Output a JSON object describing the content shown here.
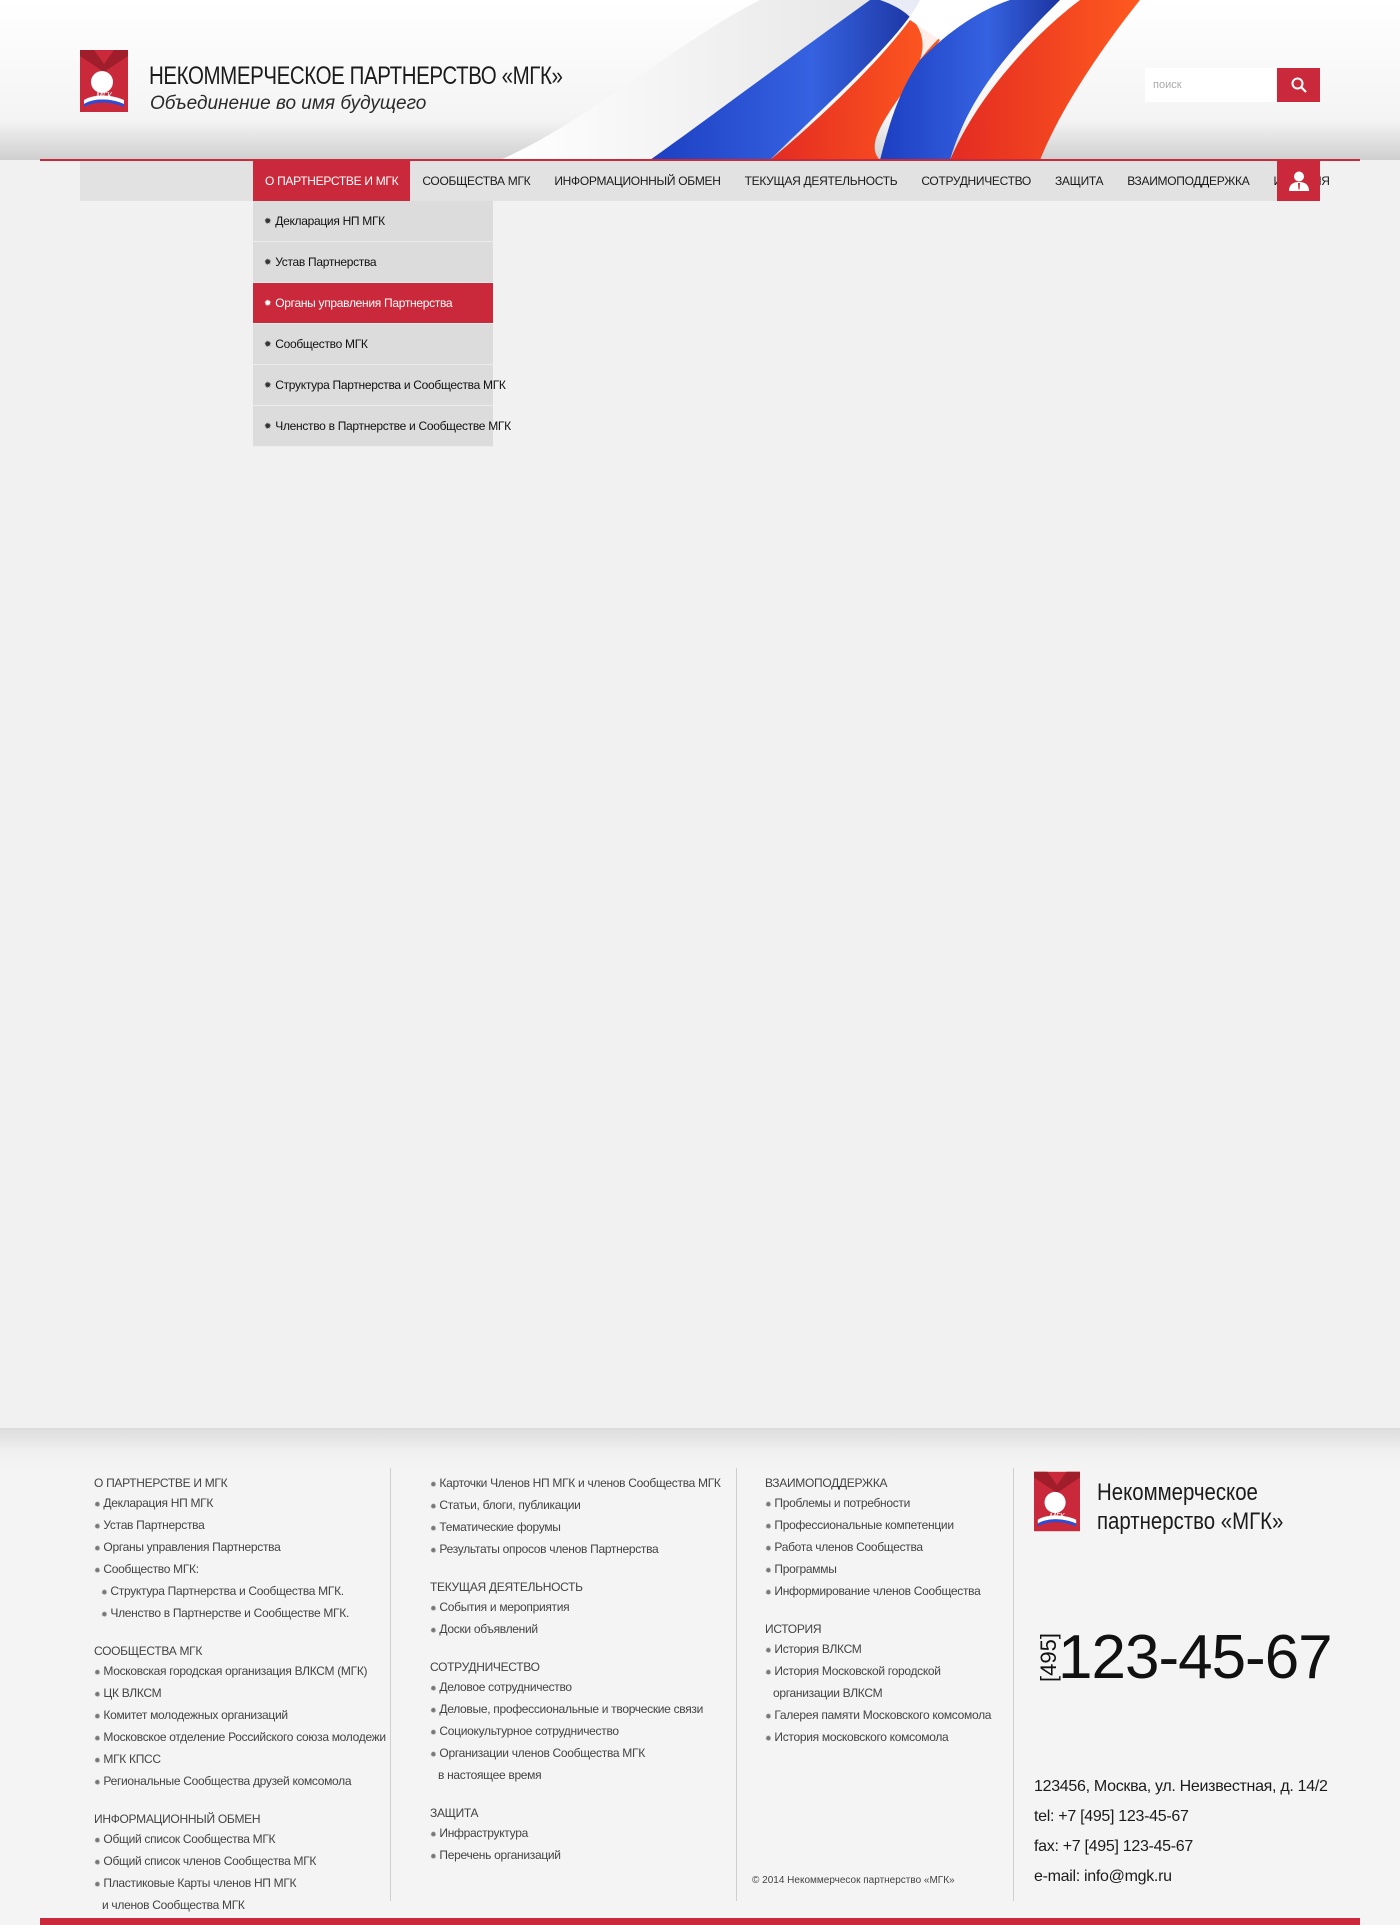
{
  "brand": {
    "title": "НЕКОММЕРЧЕСКОЕ ПАРТНЕРСТВО «МГК»",
    "tagline": "Объединение во имя будущего",
    "logo_text": "МГК"
  },
  "colors": {
    "accent": "#c9293a",
    "nav_bg": "#e2e2e2",
    "page_bg": "#f1f1f1"
  },
  "search": {
    "placeholder": "поиск"
  },
  "nav": {
    "items": [
      {
        "label": "О ПАРТНЕРСТВЕ И МГК",
        "active": true
      },
      {
        "label": "СООБЩЕСТВА МГК"
      },
      {
        "label": "ИНФОРМАЦИОННЫЙ ОБМЕН"
      },
      {
        "label": "ТЕКУЩАЯ ДЕЯТЕЛЬНОСТЬ"
      },
      {
        "label": "СОТРУДНИЧЕСТВО"
      },
      {
        "label": "ЗАЩИТА"
      },
      {
        "label": "ВЗАИМОПОДДЕРЖКА"
      },
      {
        "label": "ИСТОРИЯ"
      }
    ]
  },
  "dropdown": {
    "items": [
      {
        "label": "Декларация НП МГК"
      },
      {
        "label": "Устав Партнерства"
      },
      {
        "label": "Органы управления Партнерства",
        "active": true
      },
      {
        "label": "Сообщество МГК"
      },
      {
        "label": "Структура Партнерства и Сообщества МГК"
      },
      {
        "label": "Членство в Партнерстве и Сообществе МГК"
      }
    ]
  },
  "footer": {
    "col1": [
      {
        "head": "О ПАРТНЕРСТВЕ И МГК",
        "links": [
          {
            "t": "Декларация НП МГК"
          },
          {
            "t": "Устав Партнерства"
          },
          {
            "t": "Органы управления Партнерства"
          },
          {
            "t": "Сообщество МГК:"
          },
          {
            "t": "Структура Партнерства и Сообщества МГК.",
            "sub": true
          },
          {
            "t": "Членство в Партнерстве и Сообществе МГК.",
            "sub": true
          }
        ]
      },
      {
        "head": "СООБЩЕСТВА МГК",
        "links": [
          {
            "t": "Московская городская организация ВЛКСМ (МГК)"
          },
          {
            "t": "ЦК ВЛКСМ"
          },
          {
            "t": "Комитет молодежных организаций"
          },
          {
            "t": "Московское отделение Российского союза молодежи"
          },
          {
            "t": "МГК КПСС"
          },
          {
            "t": "Региональные Сообщества друзей комсомола"
          }
        ]
      },
      {
        "head": "ИНФОРМАЦИОННЫЙ ОБМЕН",
        "links": [
          {
            "t": "Общий список Сообщества МГК"
          },
          {
            "t": "Общий список членов Сообщества МГК"
          },
          {
            "t": "Пластиковые Карты членов НП МГК"
          },
          {
            "t": "и членов Сообщества МГК",
            "cont": true
          }
        ]
      }
    ],
    "col2": [
      {
        "head": "",
        "links": [
          {
            "t": "Карточки Членов НП МГК и членов Сообщества МГК"
          },
          {
            "t": "Статьи, блоги, публикации"
          },
          {
            "t": "Тематические форумы"
          },
          {
            "t": "Результаты опросов членов Партнерства"
          }
        ]
      },
      {
        "head": "ТЕКУЩАЯ ДЕЯТЕЛЬНОСТЬ",
        "links": [
          {
            "t": "События и мероприятия"
          },
          {
            "t": "Доски объявлений"
          }
        ]
      },
      {
        "head": "СОТРУДНИЧЕСТВО",
        "links": [
          {
            "t": "Деловое сотрудничество"
          },
          {
            "t": "Деловые, профессиональные и творческие связи"
          },
          {
            "t": "Социокультурное сотрудничество"
          },
          {
            "t": "Организации членов Сообщества МГК"
          },
          {
            "t": "в настоящее время",
            "cont": true
          }
        ]
      },
      {
        "head": "ЗАЩИТА",
        "links": [
          {
            "t": "Инфраструктура"
          },
          {
            "t": "Перечень организаций"
          }
        ]
      }
    ],
    "col3": [
      {
        "head": "ВЗАИМОПОДДЕРЖКА",
        "links": [
          {
            "t": "Проблемы и потребности"
          },
          {
            "t": "Профессиональные компетенции"
          },
          {
            "t": "Работа членов Сообщества"
          },
          {
            "t": "Программы"
          },
          {
            "t": "Информирование членов Сообщества"
          }
        ]
      },
      {
        "head": "ИСТОРИЯ",
        "links": [
          {
            "t": "История ВЛКСМ"
          },
          {
            "t": "История Московской городской"
          },
          {
            "t": "организации ВЛКСМ",
            "cont": true
          },
          {
            "t": "Галерея памяти Московского комсомола"
          },
          {
            "t": "История московского комсомола"
          }
        ]
      }
    ],
    "brand_line1": "Некоммерческое",
    "brand_line2": "партнерство «МГК»",
    "phone_code": "[495]",
    "phone_number": "123-45-67",
    "address": "123456, Москва, ул. Неизвестная, д. 14/2",
    "tel": "tel: +7 [495] 123-45-67",
    "fax": "fax: +7 [495] 123-45-67",
    "email": "e-mail: info@mgk.ru",
    "copyright": "© 2014  Некоммерчесок партнерство  «МГК»"
  }
}
